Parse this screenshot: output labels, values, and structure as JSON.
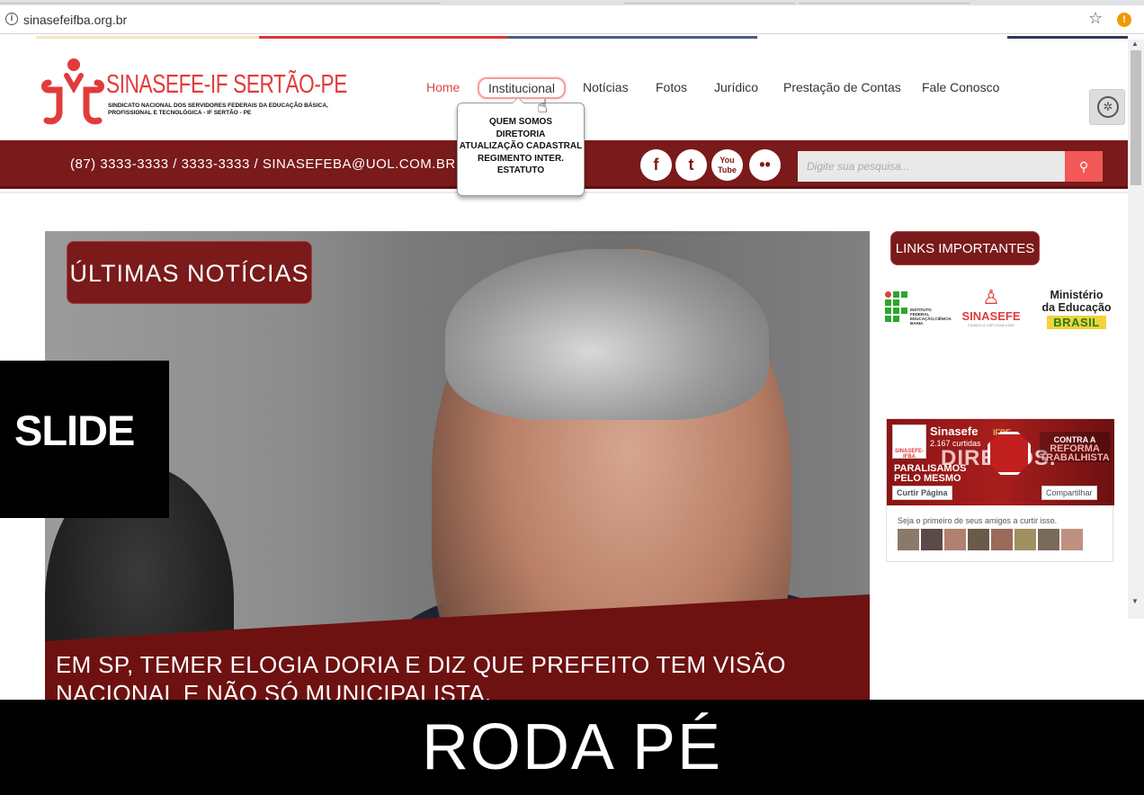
{
  "browser": {
    "url": "sinasefeifba.org.br"
  },
  "header": {
    "logo_title": "SINASEFE-IF SERTÃO-PE",
    "logo_subtitle": "SINDICATO NACIONAL DOS SERVIDORES FEDERAIS DA EDUCAÇÃO BÁSICA, PROFISSIONAL E TECNOLÓGICA - IF SERTÃO - PE",
    "nav": [
      {
        "label": "Home"
      },
      {
        "label": "Institucional"
      },
      {
        "label": "Notícias"
      },
      {
        "label": "Fotos"
      },
      {
        "label": "Jurídico"
      },
      {
        "label": "Prestação de Contas"
      },
      {
        "label": "Fale Conosco"
      }
    ],
    "dropdown": [
      "QUEM SOMOS",
      "DIRETORIA",
      "ATUALIZAÇÃO CADASTRAL",
      "REGIMENTO INTER.",
      "ESTATUTO"
    ]
  },
  "bar": {
    "contact": "(87) 3333-3333 / 3333-3333 / SINASEFEBA@UOL.COM.BR",
    "social": {
      "facebook": "f",
      "twitter": "t",
      "youtube": "You Tube",
      "flickr": "••"
    },
    "search_placeholder": "Digite sua pesquisa..."
  },
  "slide": {
    "tag": "ÚLTIMAS NOTÍCIAS",
    "headline": "EM SP, TEMER ELOGIA DORIA E DIZ QUE PREFEITO TEM VISÃO NACIONAL E NÃO SÓ MUNICIPALISTA."
  },
  "sidebar": {
    "title": "LINKS IMPORTANTES",
    "ifba_text": "INSTITUTO FEDERAL EDUCAÇÃO,CIÊNCIA BAHIA",
    "sinasefe": "SINASEFE",
    "sinasefe_tag": "FILIADO À CSP-CONLUTAS",
    "mec_line1": "Ministério",
    "mec_line2": "da Educação",
    "brasil": "BRASIL",
    "facebook": {
      "page_name": "Sinasefe",
      "page_name_extra": "IFPE",
      "likes": "2.167 curtidas",
      "cover_text": "DIREITOS.",
      "cover_sub1": "PARALISAMOS",
      "cover_sub2": "PELO MESMO",
      "cover_side1": "CONTRA A",
      "cover_side2": "REFORMA TRABALHISTA",
      "profile_label": "SINASEFE-IFBA",
      "like_button": "Curtir Página",
      "share_button": "Compartilhar",
      "friends_text": "Seja o primeiro de seus amigos a curtir isso."
    }
  },
  "overlays": {
    "slide_label": "SLIDE",
    "footer_label": "RODA PÉ"
  },
  "colors": {
    "brand_red": "#e23b3b",
    "bar_red": "#7a1a1a",
    "search_btn": "#f25858"
  }
}
